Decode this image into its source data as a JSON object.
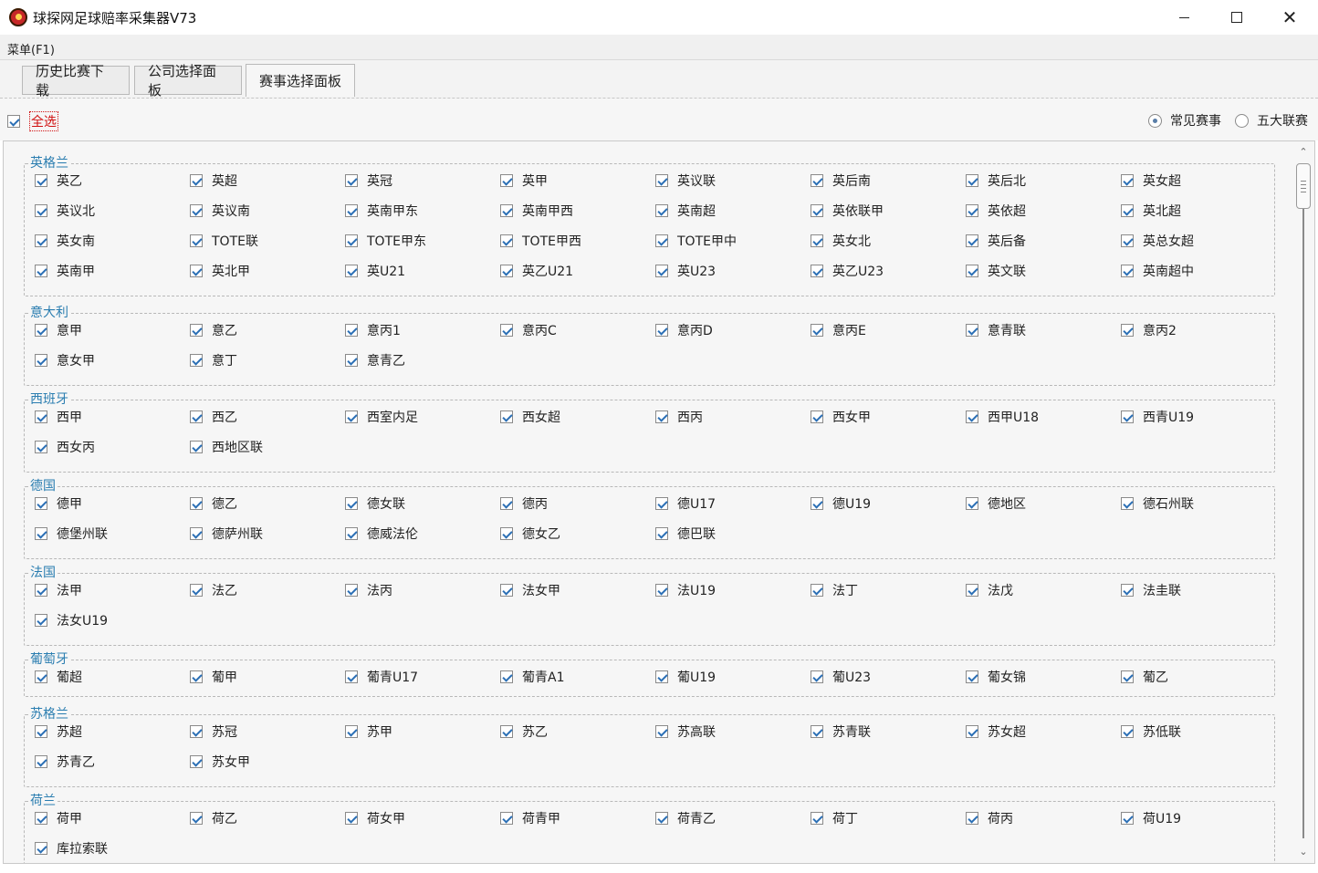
{
  "window": {
    "title": "球探网足球赔率采集器V73"
  },
  "menu": {
    "items": [
      "菜单(F1)"
    ]
  },
  "tabs": [
    {
      "label": "历史比赛下载",
      "active": false
    },
    {
      "label": "公司选择面板",
      "active": false
    },
    {
      "label": "赛事选择面板",
      "active": true
    }
  ],
  "toolbar": {
    "select_all_label": "全选",
    "select_all_checked": true,
    "radio_options": [
      {
        "label": "常见赛事",
        "selected": true
      },
      {
        "label": "五大联赛",
        "selected": false
      }
    ]
  },
  "colors": {
    "accent_blue": "#2a7db0",
    "select_all_red": "#d01010"
  },
  "groups": [
    {
      "title": "英格兰",
      "items": [
        "英乙",
        "英超",
        "英冠",
        "英甲",
        "英议联",
        "英后南",
        "英后北",
        "英女超",
        "英议北",
        "英议南",
        "英南甲东",
        "英南甲西",
        "英南超",
        "英依联甲",
        "英依超",
        "英北超",
        "英女南",
        "TOTE联",
        "TOTE甲东",
        "TOTE甲西",
        "TOTE甲中",
        "英女北",
        "英后备",
        "英总女超",
        "英南甲",
        "英北甲",
        "英U21",
        "英乙U21",
        "英U23",
        "英乙U23",
        "英文联",
        "英南超中"
      ]
    },
    {
      "title": "意大利",
      "items": [
        "意甲",
        "意乙",
        "意丙1",
        "意丙C",
        "意丙D",
        "意丙E",
        "意青联",
        "意丙2",
        "意女甲",
        "意丁",
        "意青乙"
      ]
    },
    {
      "title": "西班牙",
      "items": [
        "西甲",
        "西乙",
        "西室内足",
        "西女超",
        "西丙",
        "西女甲",
        "西甲U18",
        "西青U19",
        "西女丙",
        "西地区联"
      ]
    },
    {
      "title": "德国",
      "items": [
        "德甲",
        "德乙",
        "德女联",
        "德丙",
        "德U17",
        "德U19",
        "德地区",
        "德石州联",
        "德堡州联",
        "德萨州联",
        "德威法伦",
        "德女乙",
        "德巴联"
      ]
    },
    {
      "title": "法国",
      "items": [
        "法甲",
        "法乙",
        "法丙",
        "法女甲",
        "法U19",
        "法丁",
        "法戊",
        "法圭联",
        "法女U19"
      ]
    },
    {
      "title": "葡萄牙",
      "items": [
        "葡超",
        "葡甲",
        "葡青U17",
        "葡青A1",
        "葡U19",
        "葡U23",
        "葡女锦",
        "葡乙"
      ]
    },
    {
      "title": "苏格兰",
      "items": [
        "苏超",
        "苏冠",
        "苏甲",
        "苏乙",
        "苏高联",
        "苏青联",
        "苏女超",
        "苏低联",
        "苏青乙",
        "苏女甲"
      ]
    },
    {
      "title": "荷兰",
      "items": [
        "荷甲",
        "荷乙",
        "荷女甲",
        "荷青甲",
        "荷青乙",
        "荷丁",
        "荷丙",
        "荷U19",
        "库拉索联"
      ]
    }
  ]
}
